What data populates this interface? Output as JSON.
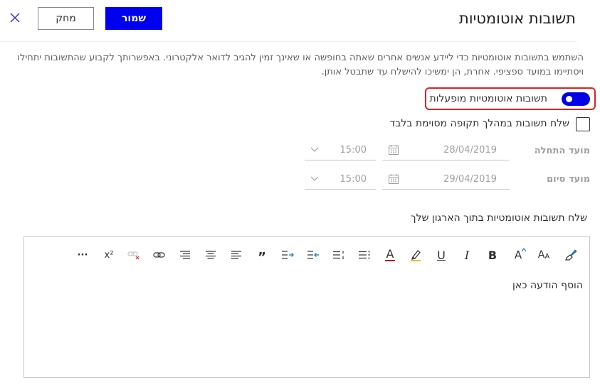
{
  "header": {
    "title": "תשובות אוטומטיות",
    "save_label": "שמור",
    "discard_label": "מחק"
  },
  "description": "השתמש בתשובות אוטומטיות כדי ליידע אנשים אחרים שאתה בחופשה או שאינך זמין להגיב לדואר אלקטרוני. באפשרותך לקבוע שהתשובות יתחילו ויסתיימו במועד ספציפי. אחרת, הן ימשיכו להישלח עד שתבטל אותן.",
  "auto_reply_toggle": {
    "label": "תשובות אוטומטיות מופעלות",
    "on": true
  },
  "time_period": {
    "label": "שלח תשובות במהלך תקופה מסוימת בלבד",
    "checked": false
  },
  "start": {
    "label": "מועד התחלה",
    "date": "28/04/2019",
    "time": "15:00"
  },
  "end": {
    "label": "מועד סיום",
    "date": "29/04/2019",
    "time": "15:00"
  },
  "org_section_label": "שלח תשובות אוטומטיות בתוך הארגון שלך",
  "editor": {
    "placeholder": "הוסף הודעה כאן",
    "more_label": "···",
    "superscript_label": "x²",
    "quote_label": "”",
    "bold_label": "B",
    "italic_label": "I",
    "underline_label": "U",
    "font_size_label": "A",
    "font_label": "A"
  },
  "colors": {
    "accent": "#0000f0",
    "highlight_border": "#e02020",
    "font_color_bar": "#c50f1f",
    "highlight_bar": "#ffb900"
  }
}
